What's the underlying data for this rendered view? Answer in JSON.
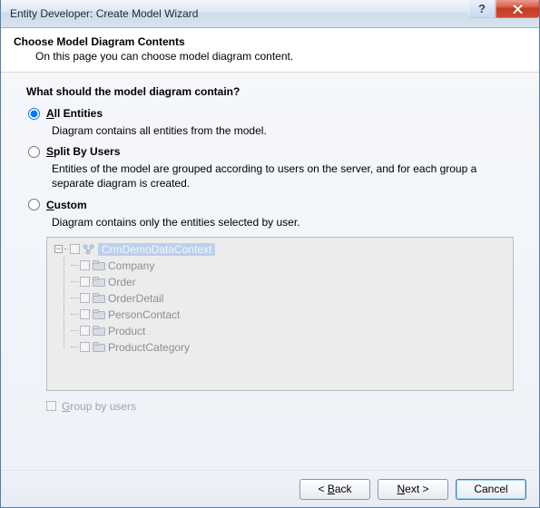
{
  "window": {
    "title": "Entity Developer: Create Model Wizard"
  },
  "header": {
    "title": "Choose Model Diagram Contents",
    "subtitle": "On this page you can choose model diagram content."
  },
  "question": "What should the model diagram contain?",
  "options": {
    "all": {
      "label_pre": "A",
      "label_rest": "ll Entities",
      "desc": "Diagram contains all entities from the model."
    },
    "split": {
      "label_pre": "S",
      "label_rest": "plit By Users",
      "desc": "Entities of the model are grouped according to users on the server, and for each group a separate diagram is created."
    },
    "custom": {
      "label_pre": "C",
      "label_rest": "ustom",
      "desc": "Diagram contains only the entities selected by user."
    }
  },
  "tree": {
    "root": "CrmDemoDataContext",
    "children": [
      "Company",
      "Order",
      "OrderDetail",
      "PersonContact",
      "Product",
      "ProductCategory"
    ]
  },
  "groupby": {
    "label_pre": "G",
    "label_rest": "roup by users"
  },
  "buttons": {
    "back_pre": "< ",
    "back_ul": "B",
    "back_rest": "ack",
    "next_ul": "N",
    "next_rest": "ext",
    "next_post": " >",
    "cancel": "Cancel"
  }
}
